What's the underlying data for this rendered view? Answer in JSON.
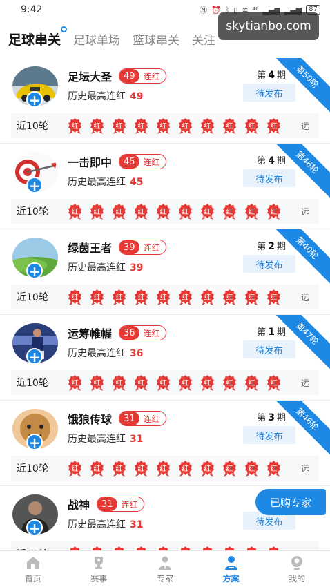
{
  "status": {
    "time": "9:42",
    "signal": "⁴⁶",
    "battery": "87"
  },
  "tabs": [
    {
      "label": "足球串关",
      "active": true
    },
    {
      "label": "足球单场",
      "active": false
    },
    {
      "label": "篮球串关",
      "active": false
    },
    {
      "label": "关注",
      "active": false
    }
  ],
  "watermark": "skytianbo.com",
  "labels": {
    "streak": "连红",
    "history": "历史最高连红",
    "period_prefix": "第",
    "period_suffix": "期",
    "pending": "待发布",
    "recent": "近10轮",
    "badge": "红",
    "far": "远"
  },
  "experts": [
    {
      "name": "足坛大圣",
      "streak": "49",
      "best": "49",
      "period": "4",
      "round": "第50轮",
      "avatar": "car"
    },
    {
      "name": "一击即中",
      "streak": "45",
      "best": "45",
      "period": "4",
      "round": "第46轮",
      "avatar": "target"
    },
    {
      "name": "绿茵王者",
      "streak": "39",
      "best": "39",
      "period": "2",
      "round": "第40轮",
      "avatar": "field"
    },
    {
      "name": "运筹帷幄",
      "streak": "36",
      "best": "36",
      "period": "1",
      "round": "第47轮",
      "avatar": "player"
    },
    {
      "name": "饿狼传球",
      "streak": "31",
      "best": "31",
      "period": "3",
      "round": "第46轮",
      "avatar": "monk"
    },
    {
      "name": "战神",
      "streak": "31",
      "best": "31",
      "period": "",
      "round": "",
      "avatar": "man"
    }
  ],
  "bought_button": "已购专家",
  "nav": [
    {
      "label": "首页",
      "icon": "home-icon",
      "active": false
    },
    {
      "label": "赛事",
      "icon": "trophy-icon",
      "active": false
    },
    {
      "label": "专家",
      "icon": "expert-icon",
      "active": false
    },
    {
      "label": "方案",
      "icon": "plan-icon",
      "active": true
    },
    {
      "label": "我的",
      "icon": "profile-icon",
      "active": false
    }
  ]
}
